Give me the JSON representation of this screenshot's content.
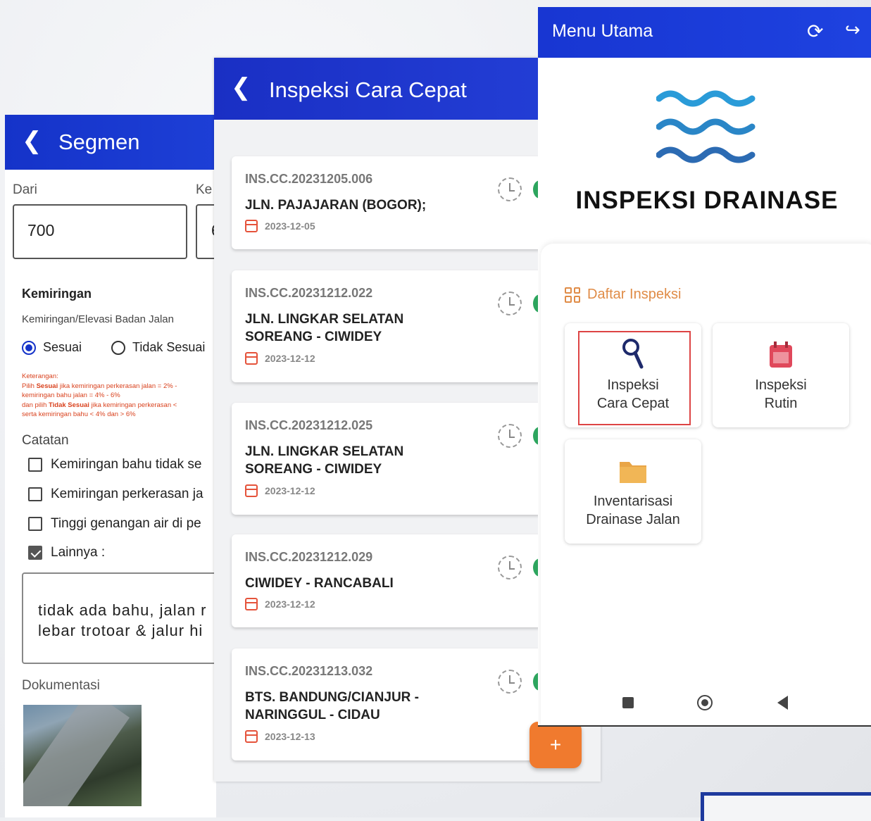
{
  "segmen": {
    "title": "Segmen",
    "back_icon": "chevron-left-icon",
    "dari_label": "Dari",
    "ke_label": "Ke",
    "dari_value": "700",
    "ke_value": "6",
    "section_title": "Kemiringan",
    "section_sub": "Kemiringan/Elevasi Badan Jalan",
    "radio_options": [
      {
        "label": "Sesuai",
        "selected": true
      },
      {
        "label": "Tidak Sesuai",
        "selected": false
      }
    ],
    "note": {
      "heading": "Keterangan:",
      "line1_pre": "Pilih ",
      "line1_bold": "Sesuai",
      "line1_post": " jika kemiringan perkerasan jalan = 2% -",
      "line2": "kemiringan bahu jalan = 4% - 6%",
      "line3_pre": "dan pilih ",
      "line3_bold": "Tidak Sesuai",
      "line3_post": " jika kemiringan perkerasan <",
      "line4": "serta kemiringan bahu < 4% dan > 6%"
    },
    "catatan_label": "Catatan",
    "checkboxes": [
      {
        "label": "Kemiringan bahu tidak se",
        "checked": false
      },
      {
        "label": "Kemiringan perkerasan ja",
        "checked": false
      },
      {
        "label": "Tinggi genangan air di pe",
        "checked": false
      },
      {
        "label": "Lainnya :",
        "checked": true
      }
    ],
    "notes_text": "tidak ada bahu, jalan r\nlebar trotoar & jalur hi",
    "dokumentasi_label": "Dokumentasi"
  },
  "cara_cepat": {
    "title": "Inspeksi Cara Cepat",
    "back_icon": "chevron-left-icon",
    "fab_label": "+",
    "items": [
      {
        "code": "INS.CC.20231205.006",
        "name": "JLN. PAJAJARAN (BOGOR);",
        "date": "2023-12-05"
      },
      {
        "code": "INS.CC.20231212.022",
        "name": "JLN. LINGKAR SELATAN SOREANG - CIWIDEY",
        "date": "2023-12-12"
      },
      {
        "code": "INS.CC.20231212.025",
        "name": "JLN. LINGKAR SELATAN SOREANG - CIWIDEY",
        "date": "2023-12-12"
      },
      {
        "code": "INS.CC.20231212.029",
        "name": "CIWIDEY - RANCABALI",
        "date": "2023-12-12"
      },
      {
        "code": "INS.CC.20231213.032",
        "name": "BTS. BANDUNG/CIANJUR - NARINGGUL - CIDAU",
        "date": "2023-12-13"
      }
    ]
  },
  "menu_utama": {
    "title": "Menu Utama",
    "sync_icon": "sync-icon",
    "logout_icon": "logout-icon",
    "brand": "INSPEKSI DRAINASE",
    "list_heading": "Daftar Inspeksi",
    "tiles": [
      {
        "label": "Inspeksi\nCara Cepat",
        "icon": "search-icon"
      },
      {
        "label": "Inspeksi\nRutin",
        "icon": "calendar-icon"
      },
      {
        "label": "Inventarisasi\nDrainase Jalan",
        "icon": "folder-icon"
      }
    ],
    "colors": {
      "primary": "#1836d2",
      "accent": "#f07a2e",
      "highlight": "#e08c47",
      "wave": "#2a86c7"
    }
  }
}
